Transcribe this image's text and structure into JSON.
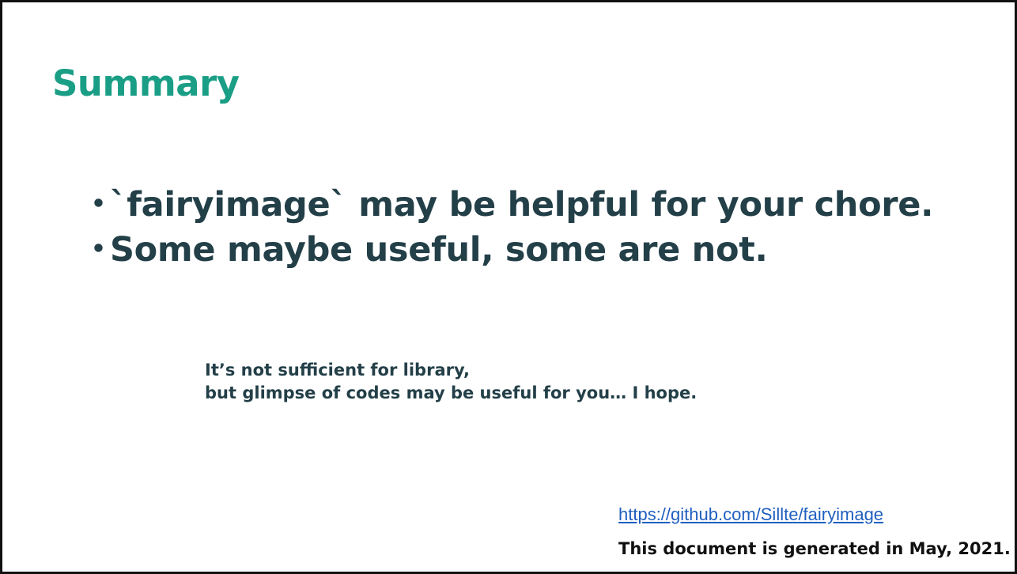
{
  "slide": {
    "title": "Summary",
    "bullets": [
      {
        "marker": "・",
        "text": "`fairyimage` may be helpful for your chore."
      },
      {
        "marker": "・",
        "text": "Some maybe useful, some are not."
      }
    ],
    "note_lines": [
      "It’s not sufficient for library,",
      "but glimpse of codes may be useful for you… I hope."
    ],
    "link_text": "https://github.com/Sillte/fairyimage",
    "footer_text": "This document is generated in May, 2021."
  },
  "colors": {
    "title": "#1a9e86",
    "body_text": "#233f48",
    "link": "#1f5fbf",
    "border": "#111111"
  }
}
